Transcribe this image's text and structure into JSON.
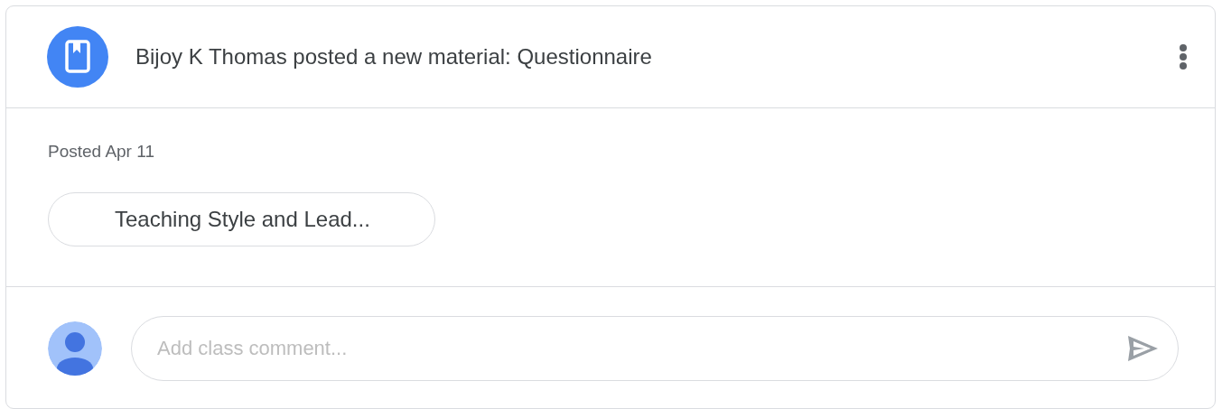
{
  "post": {
    "title": "Bijoy K Thomas posted a new material: Questionnaire",
    "posted": "Posted Apr 11"
  },
  "attachments": [
    {
      "label": "Teaching Style and Lead..."
    }
  ],
  "comment": {
    "placeholder": "Add class comment..."
  }
}
